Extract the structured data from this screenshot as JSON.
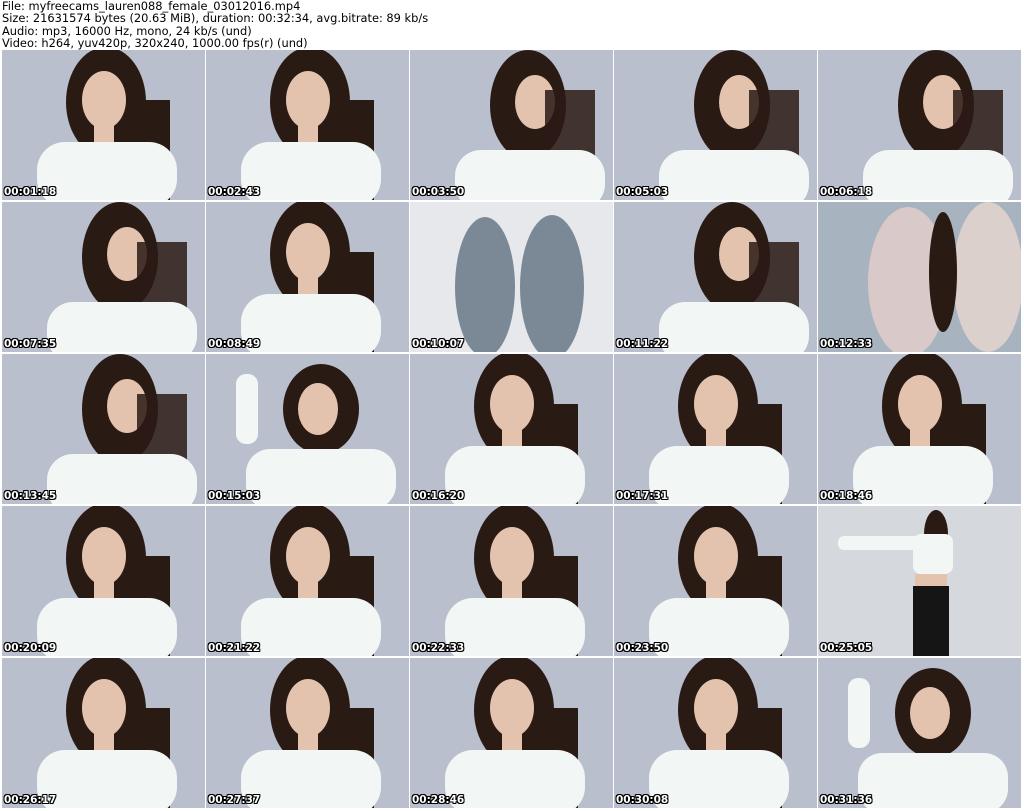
{
  "header": {
    "file_line": "File: myfreecams_lauren088_female_03012016.mp4",
    "size_line": "Size: 21631574 bytes (20.63 MiB), duration: 00:32:34, avg.bitrate: 89 kb/s",
    "audio_line": "Audio: mp3, 16000 Hz, mono, 24 kb/s (und)",
    "video_line": "Video: h264, yuv420p, 320x240, 1000.00 fps(r) (und)"
  },
  "colors": {
    "background": "#ffffff",
    "wall": "#b9bfcc",
    "hair": "#2a1a14",
    "skin": "#e3c2ae",
    "sweater": "#f2f7f6",
    "sock": "#7b8896"
  },
  "thumbs": [
    {
      "time": "00:01:18",
      "scene": "portrait-front"
    },
    {
      "time": "00:02:43",
      "scene": "portrait-front"
    },
    {
      "time": "00:03:50",
      "scene": "portrait-side"
    },
    {
      "time": "00:05:03",
      "scene": "portrait-side"
    },
    {
      "time": "00:06:18",
      "scene": "portrait-side"
    },
    {
      "time": "00:07:35",
      "scene": "portrait-side"
    },
    {
      "time": "00:08:49",
      "scene": "portrait-front"
    },
    {
      "time": "00:10:07",
      "scene": "socks"
    },
    {
      "time": "00:11:22",
      "scene": "portrait-side"
    },
    {
      "time": "00:12:33",
      "scene": "feet"
    },
    {
      "time": "00:13:45",
      "scene": "portrait-side"
    },
    {
      "time": "00:15:03",
      "scene": "arms-up"
    },
    {
      "time": "00:16:20",
      "scene": "portrait-front"
    },
    {
      "time": "00:17:31",
      "scene": "portrait-front"
    },
    {
      "time": "00:18:46",
      "scene": "portrait-front"
    },
    {
      "time": "00:20:09",
      "scene": "portrait-front"
    },
    {
      "time": "00:21:22",
      "scene": "portrait-front"
    },
    {
      "time": "00:22:33",
      "scene": "portrait-front"
    },
    {
      "time": "00:23:50",
      "scene": "portrait-front"
    },
    {
      "time": "00:25:05",
      "scene": "standing"
    },
    {
      "time": "00:26:17",
      "scene": "portrait-front"
    },
    {
      "time": "00:27:37",
      "scene": "portrait-front"
    },
    {
      "time": "00:28:46",
      "scene": "portrait-front"
    },
    {
      "time": "00:30:08",
      "scene": "portrait-front"
    },
    {
      "time": "00:31:36",
      "scene": "arms-up"
    }
  ]
}
